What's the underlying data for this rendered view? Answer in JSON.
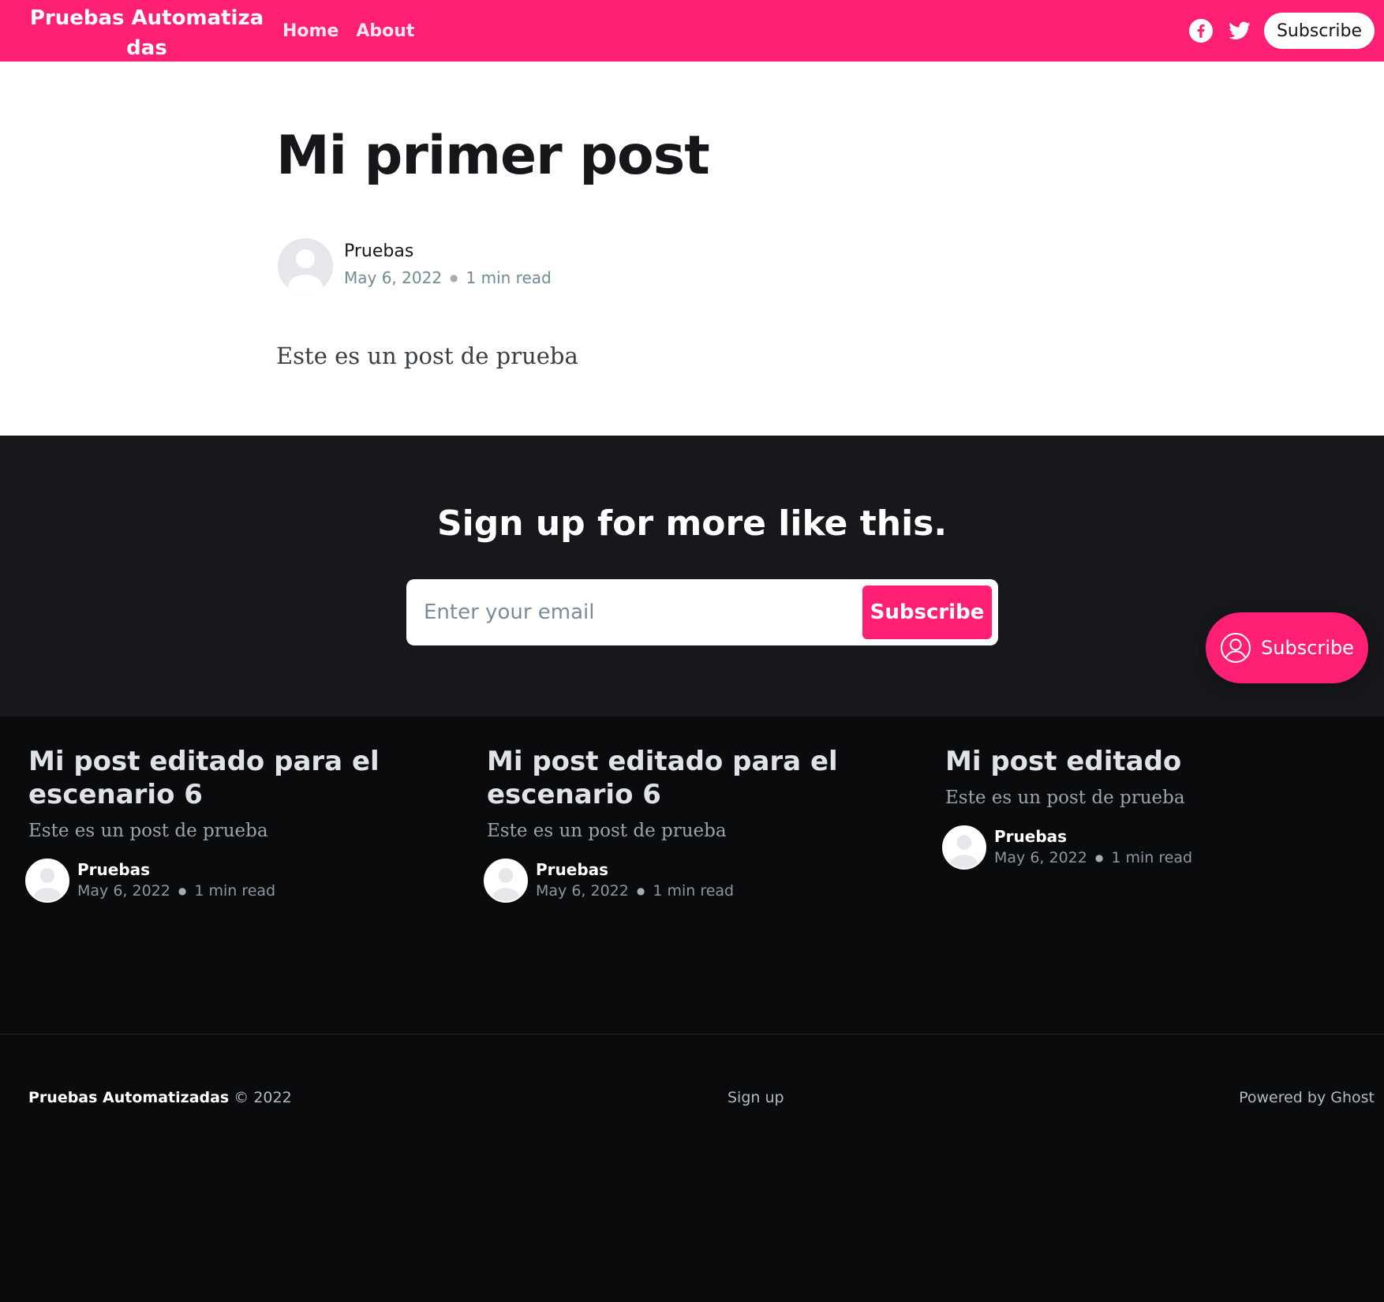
{
  "header": {
    "site_title": "Pruebas Automatizadas",
    "nav": [
      {
        "label": "Home"
      },
      {
        "label": "About"
      }
    ],
    "social_icons": [
      "facebook-icon",
      "twitter-icon"
    ],
    "subscribe_label": "Subscribe",
    "brand_color": "#ff1f75"
  },
  "post": {
    "title": "Mi primer post",
    "author": "Pruebas",
    "date": "May 6, 2022",
    "reading_time": "1 min read",
    "body": "Este es un post de prueba"
  },
  "signup": {
    "title": "Sign up for more like this.",
    "email_placeholder": "Enter your email",
    "button_label": "Subscribe"
  },
  "portal": {
    "label": "Subscribe",
    "icon": "user-circle-icon"
  },
  "related": [
    {
      "title": "Mi post editado para el escenario 6",
      "excerpt": "Este es un post de prueba",
      "author": "Pruebas",
      "date": "May 6, 2022",
      "reading_time": "1 min read"
    },
    {
      "title": "Mi post editado para el escenario 6",
      "excerpt": "Este es un post de prueba",
      "author": "Pruebas",
      "date": "May 6, 2022",
      "reading_time": "1 min read"
    },
    {
      "title": "Mi post editado",
      "excerpt": "Este es un post de prueba",
      "author": "Pruebas",
      "date": "May 6, 2022",
      "reading_time": "1 min read"
    }
  ],
  "footer": {
    "site_name": "Pruebas Automatizadas",
    "copyright": "© 2022",
    "signup_link": "Sign up",
    "powered_by": "Powered by Ghost"
  }
}
